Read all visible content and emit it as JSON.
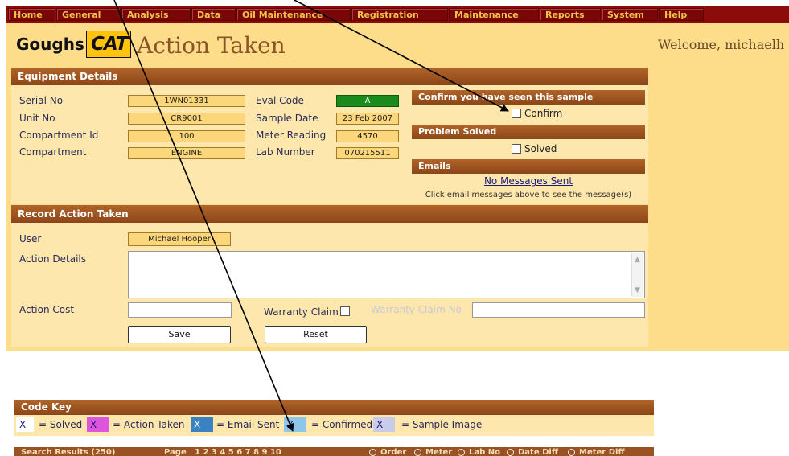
{
  "nav": {
    "items": [
      "Home",
      "General",
      "Analysis",
      "Data",
      "Oil Maintenance",
      "Registration",
      "Maintenance",
      "Reports",
      "System",
      "Help"
    ]
  },
  "header": {
    "brand_goughs": "Goughs",
    "brand_cat": "CAT",
    "title": "Action Taken",
    "welcome": "Welcome, michaelh"
  },
  "equipment": {
    "header": "Equipment Details",
    "serial_label": "Serial No",
    "serial_value": "1WN01331",
    "unit_label": "Unit No",
    "unit_value": "CR9001",
    "compartment_id_label": "Compartment Id",
    "compartment_id_value": "100",
    "compartment_label": "Compartment",
    "compartment_value": "ENGINE",
    "eval_label": "Eval Code",
    "eval_value": "A",
    "sample_date_label": "Sample Date",
    "sample_date_value": "23 Feb 2007",
    "meter_label": "Meter Reading",
    "meter_value": "4570",
    "lab_label": "Lab Number",
    "lab_value": "070215511",
    "eval_color": "#1a8a1a"
  },
  "confirm": {
    "header": "Confirm you have seen this sample",
    "checkbox_label": "Confirm"
  },
  "solved": {
    "header": "Problem Solved",
    "checkbox_label": "Solved"
  },
  "emails": {
    "header": "Emails",
    "link": "No Messages Sent",
    "hint": "Click email messages above to see the message(s)"
  },
  "record": {
    "header": "Record Action Taken",
    "user_label": "User",
    "user_value": "Michael Hooper",
    "details_label": "Action Details",
    "cost_label": "Action Cost",
    "warranty_label": "Warranty Claim",
    "warranty_no_label": "Warranty Claim No",
    "save": "Save",
    "reset": "Reset"
  },
  "codekey": {
    "header": "Code Key",
    "items": [
      {
        "symbol": "X",
        "text": "= Solved",
        "color": "#ffffff"
      },
      {
        "symbol": "X",
        "text": "= Action Taken",
        "color": "#dd55dd"
      },
      {
        "symbol": "X",
        "text": "= Email Sent",
        "color": "#3b82c4"
      },
      {
        "symbol": "X",
        "text": "= Confirmed",
        "color": "#8ec6ea"
      },
      {
        "symbol": "X",
        "text": "= Sample Image",
        "color": "#c8cce8"
      }
    ]
  },
  "search": {
    "header": "Search Results (250)",
    "page_label": "Page",
    "pages": "1 2 3 4 5 6 7 8 9 10",
    "sort_options": [
      "Order",
      "Meter",
      "Lab No",
      "Date Diff",
      "Meter Diff"
    ]
  }
}
